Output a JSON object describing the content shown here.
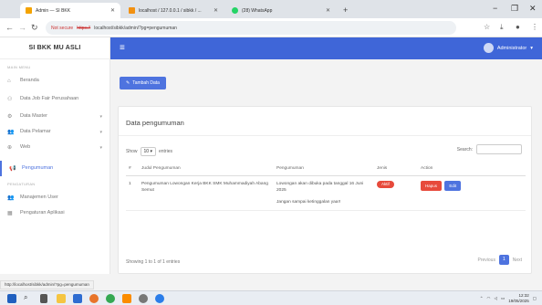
{
  "browser": {
    "tabs": [
      {
        "title": "Admin — SI BKK",
        "color": "#f4a300"
      },
      {
        "title": "localhost / 127.0.0.1 / sibkk / ...",
        "color": "#f29111"
      },
      {
        "title": "(28) WhatsApp",
        "color": "#25d366"
      }
    ],
    "new_tab": "+",
    "not_secure": "Not secure",
    "url_https": "https://",
    "url_rest": "localhost/sibkk/admin/?pg=pengumuman",
    "status_url": "http://localhost/sibkk/admin/?pg=pengumuman"
  },
  "sidebar": {
    "brand": "SI BKK MU ASLI",
    "section_main": "MAIN MENU",
    "section_settings": "PENGATURAN",
    "items": [
      {
        "label": "Beranda",
        "icon": "home-icon"
      },
      {
        "label": "Data Job Fair Perusahaan",
        "icon": "sitemap-icon"
      },
      {
        "label": "Data Master",
        "icon": "gear-icon"
      },
      {
        "label": "Data Pelamar",
        "icon": "users-icon"
      },
      {
        "label": "Web",
        "icon": "globe-icon"
      },
      {
        "label": "Pengumuman",
        "icon": "megaphone-icon"
      },
      {
        "label": "Manajemen User",
        "icon": "users-icon"
      },
      {
        "label": "Pengaturan Aplikasi",
        "icon": "building-icon"
      }
    ]
  },
  "topbar": {
    "user": "Administrator"
  },
  "main": {
    "add_button": "Tambah Data",
    "card_title": "Data pengumuman",
    "show_label": "Show",
    "show_value": "10",
    "entries_label": "entries",
    "search_label": "Search:",
    "columns": [
      "#",
      "Judul Pengumuman",
      "Pengumuman",
      "Jenis",
      "Action"
    ],
    "rows": [
      {
        "no": "1",
        "judul": "Pengumuman Lowongan Kerja BKK SMK Muhammadiyah Abang Semut",
        "isi1": "Lowongan akan dibuka pada tanggal 16 Juni 2025",
        "isi2": "Jangan sampai ketinggalan yaa!!",
        "jenis": "Aktif",
        "hapus": "Hapus",
        "edit": "Edit"
      }
    ],
    "info": "Showing 1 to 1 of 1 entries",
    "previous": "Previous",
    "page": "1",
    "next": "Next"
  },
  "taskbar": {
    "time": "12:32",
    "date": "19/05/2025"
  },
  "colors": {
    "primary": "#4e73df",
    "danger": "#e74a3b"
  }
}
